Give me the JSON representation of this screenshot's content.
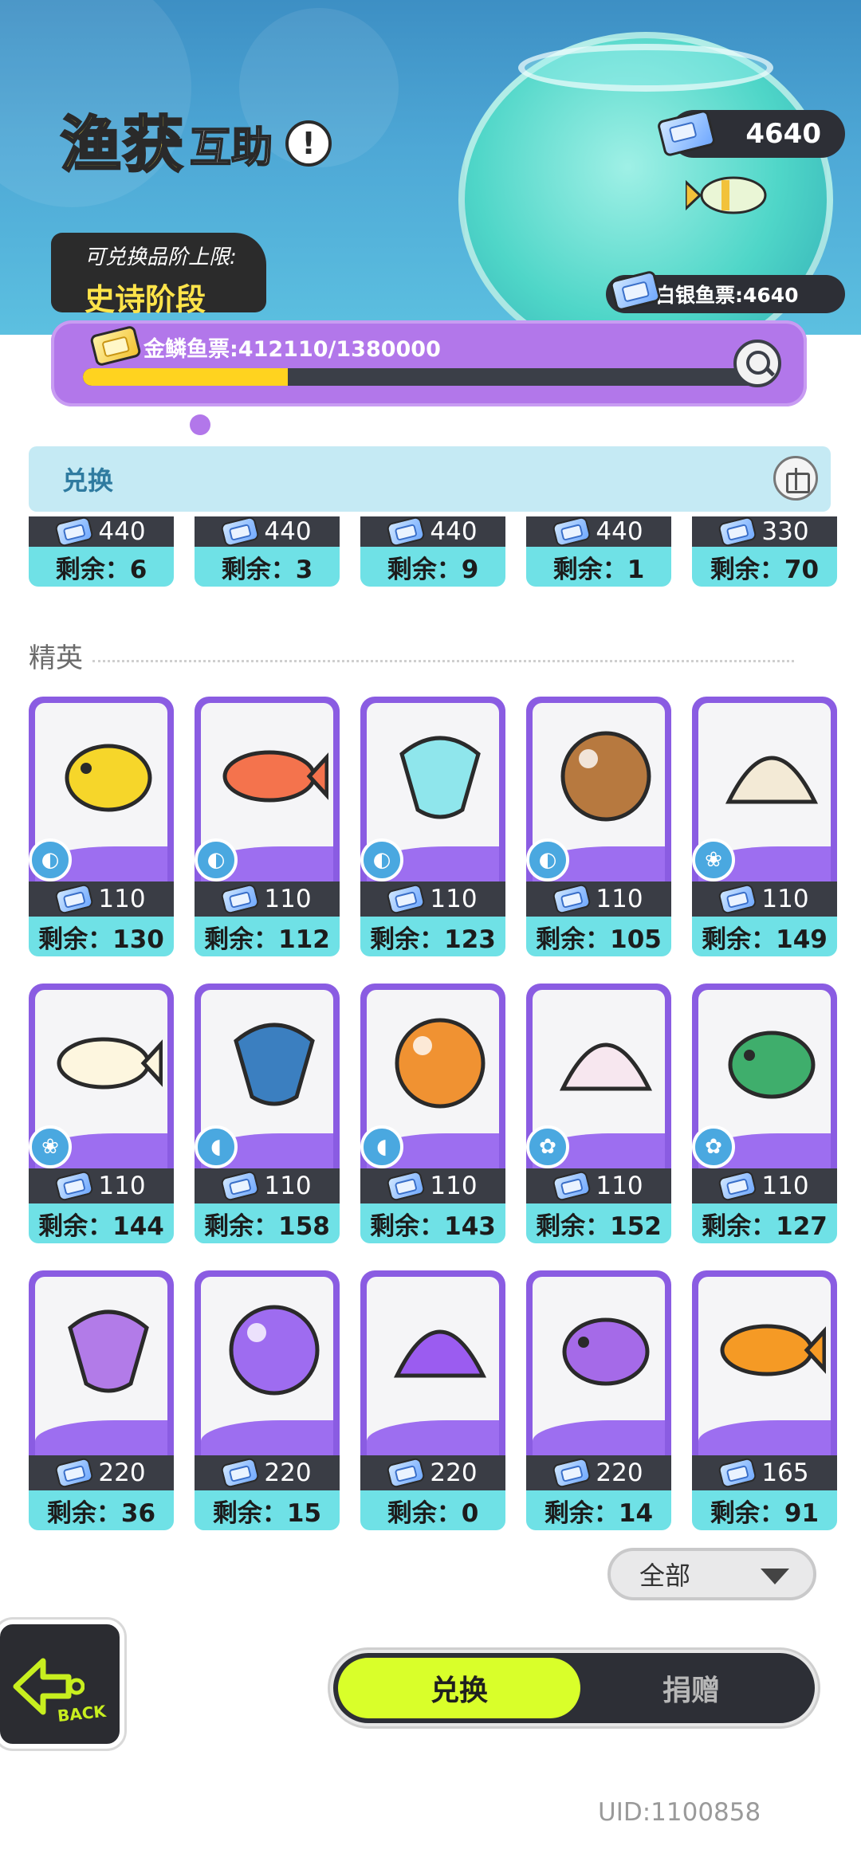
{
  "header": {
    "title_main": "渔获",
    "title_sub": "互助",
    "info_symbol": "!",
    "currency_amount": "4640",
    "tier_label": "可兑换品阶上限:",
    "tier_value": "史诗阶段",
    "silver_ticket_text": "白银鱼票:4640"
  },
  "progress": {
    "label": "金鳞鱼票:412110/1380000",
    "current": 412110,
    "max": 1380000
  },
  "exchange_section": {
    "title": "兑换"
  },
  "top_row": [
    {
      "price": "440",
      "remain": "剩余：6"
    },
    {
      "price": "440",
      "remain": "剩余：3"
    },
    {
      "price": "440",
      "remain": "剩余：9"
    },
    {
      "price": "440",
      "remain": "剩余：1"
    },
    {
      "price": "330",
      "remain": "剩余：70"
    }
  ],
  "elite_label": "精英",
  "elite_rows": [
    [
      {
        "name": "yellow-puffer-fish",
        "badge": "fish-badge",
        "price": "110",
        "remain": "剩余：130",
        "color": "#f6d62a"
      },
      {
        "name": "red-snapper-fish",
        "badge": "fish-badge",
        "price": "110",
        "remain": "剩余：112",
        "color": "#f4734d"
      },
      {
        "name": "ice-crystal-creature",
        "badge": "fish-badge",
        "price": "110",
        "remain": "剩余：123",
        "color": "#8fe6ec"
      },
      {
        "name": "capybara-mermaid",
        "badge": "fish-badge",
        "price": "110",
        "remain": "剩余：105",
        "color": "#b7793f"
      },
      {
        "name": "scallop-shell",
        "badge": "shell-badge",
        "price": "110",
        "remain": "剩余：149",
        "color": "#f3ead6"
      }
    ],
    [
      {
        "name": "white-pearl",
        "badge": "shell-badge",
        "price": "110",
        "remain": "剩余：144",
        "color": "#fdf6df"
      },
      {
        "name": "blue-flip-flop",
        "badge": "sandal-badge",
        "price": "110",
        "remain": "剩余：158",
        "color": "#3b7fc0"
      },
      {
        "name": "orange-slipper",
        "badge": "sandal-badge",
        "price": "110",
        "remain": "剩余：143",
        "color": "#f09232"
      },
      {
        "name": "pink-puffball",
        "badge": "creature-badge",
        "price": "110",
        "remain": "剩余：152",
        "color": "#f7e7ef"
      },
      {
        "name": "peacock-sprite",
        "badge": "creature-badge",
        "price": "110",
        "remain": "剩余：127",
        "color": "#3fae6c"
      }
    ],
    [
      {
        "name": "purple-fish-tail",
        "badge": "none",
        "price": "220",
        "remain": "剩余：36",
        "color": "#b27be8"
      },
      {
        "name": "purple-conch",
        "badge": "none",
        "price": "220",
        "remain": "剩余：15",
        "color": "#9e6cf0"
      },
      {
        "name": "purple-pearl",
        "badge": "none",
        "price": "220",
        "remain": "剩余：0",
        "color": "#9b5cf0"
      },
      {
        "name": "purple-coral",
        "badge": "none",
        "price": "220",
        "remain": "剩余：14",
        "color": "#a56ae8"
      },
      {
        "name": "sea-urchin-shell",
        "badge": "none",
        "price": "165",
        "remain": "剩余：91",
        "color": "#f59a25"
      }
    ]
  ],
  "filter": {
    "selected": "全部"
  },
  "back": {
    "label": "BACK"
  },
  "toggle": {
    "active": "兑换",
    "inactive": "捐赠"
  },
  "uid": "UID:1100858"
}
